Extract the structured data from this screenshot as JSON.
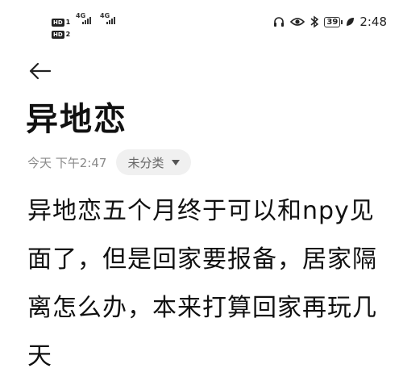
{
  "status_bar": {
    "sim1_badge": "HD",
    "sim1_num": "1",
    "sim2_badge": "HD",
    "sim2_num": "2",
    "net1": "4G",
    "net2": "4G",
    "battery": "39",
    "time": "2:48",
    "icons": [
      "headphones-icon",
      "eye-icon",
      "bluetooth-icon",
      "battery-icon",
      "leaf-icon"
    ]
  },
  "header": {
    "back_icon": "back-arrow-icon"
  },
  "note": {
    "title": "异地恋",
    "date": "今天 下午2:47",
    "category": "未分类",
    "body": "异地恋五个月终于可以和npy见面了，但是回家要报备，居家隔离怎么办，本来打算回家再玩几天"
  }
}
